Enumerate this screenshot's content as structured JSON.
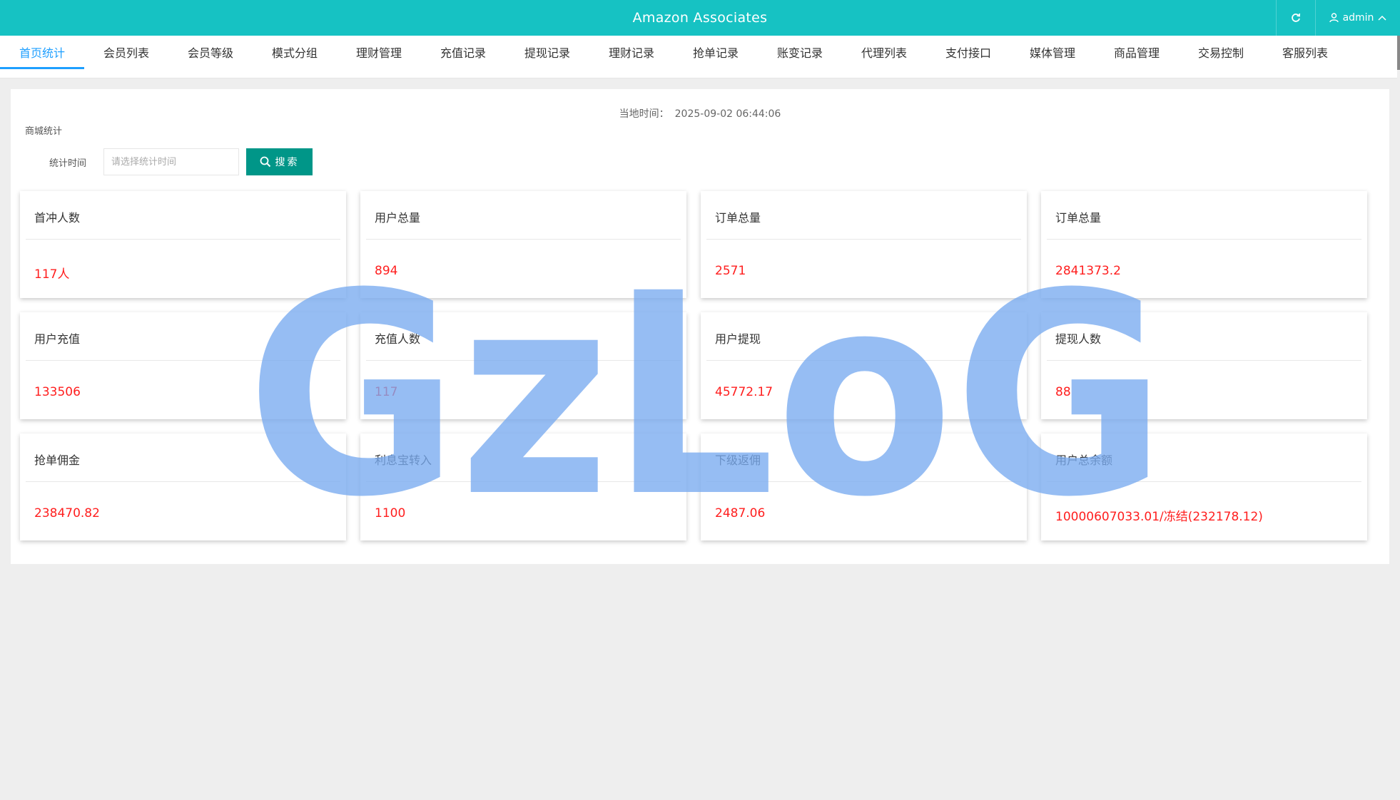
{
  "header": {
    "title": "Amazon Associates",
    "user": "admin",
    "accent_color": "#16c2c3"
  },
  "nav": {
    "tabs": [
      {
        "label": "首页统计",
        "active": true
      },
      {
        "label": "会员列表"
      },
      {
        "label": "会员等级"
      },
      {
        "label": "模式分组"
      },
      {
        "label": "理财管理"
      },
      {
        "label": "充值记录"
      },
      {
        "label": "提现记录"
      },
      {
        "label": "理财记录"
      },
      {
        "label": "抢单记录"
      },
      {
        "label": "账变记录"
      },
      {
        "label": "代理列表"
      },
      {
        "label": "支付接口"
      },
      {
        "label": "媒体管理"
      },
      {
        "label": "商品管理"
      },
      {
        "label": "交易控制"
      },
      {
        "label": "客服列表"
      }
    ]
  },
  "main": {
    "local_time_label": "当地时间：",
    "local_time_value": "2025-09-02 06:44:06",
    "section_title": "商城统计",
    "filter": {
      "label": "统计时间",
      "placeholder": "请选择统计时间",
      "value": "",
      "search_label": "搜索"
    },
    "cards": [
      {
        "title": "首冲人数",
        "value": "117人"
      },
      {
        "title": "用户总量",
        "value": "894"
      },
      {
        "title": "订单总量",
        "value": "2571"
      },
      {
        "title": "订单总量",
        "value": "2841373.2"
      },
      {
        "title": "用户充值",
        "value": "133506"
      },
      {
        "title": "充值人数",
        "value": "117"
      },
      {
        "title": "用户提现",
        "value": "45772.17"
      },
      {
        "title": "提现人数",
        "value": "88"
      },
      {
        "title": "抢单佣金",
        "value": "238470.82"
      },
      {
        "title": "利息宝转入",
        "value": "1100"
      },
      {
        "title": "下级返佣",
        "value": "2487.06"
      },
      {
        "title": "用户总余额",
        "value": "10000607033.01/冻结(232178.12)"
      }
    ],
    "value_color": "#ff1e1e"
  },
  "watermark": {
    "text": "GzLoG",
    "color": "#78aaf0"
  }
}
